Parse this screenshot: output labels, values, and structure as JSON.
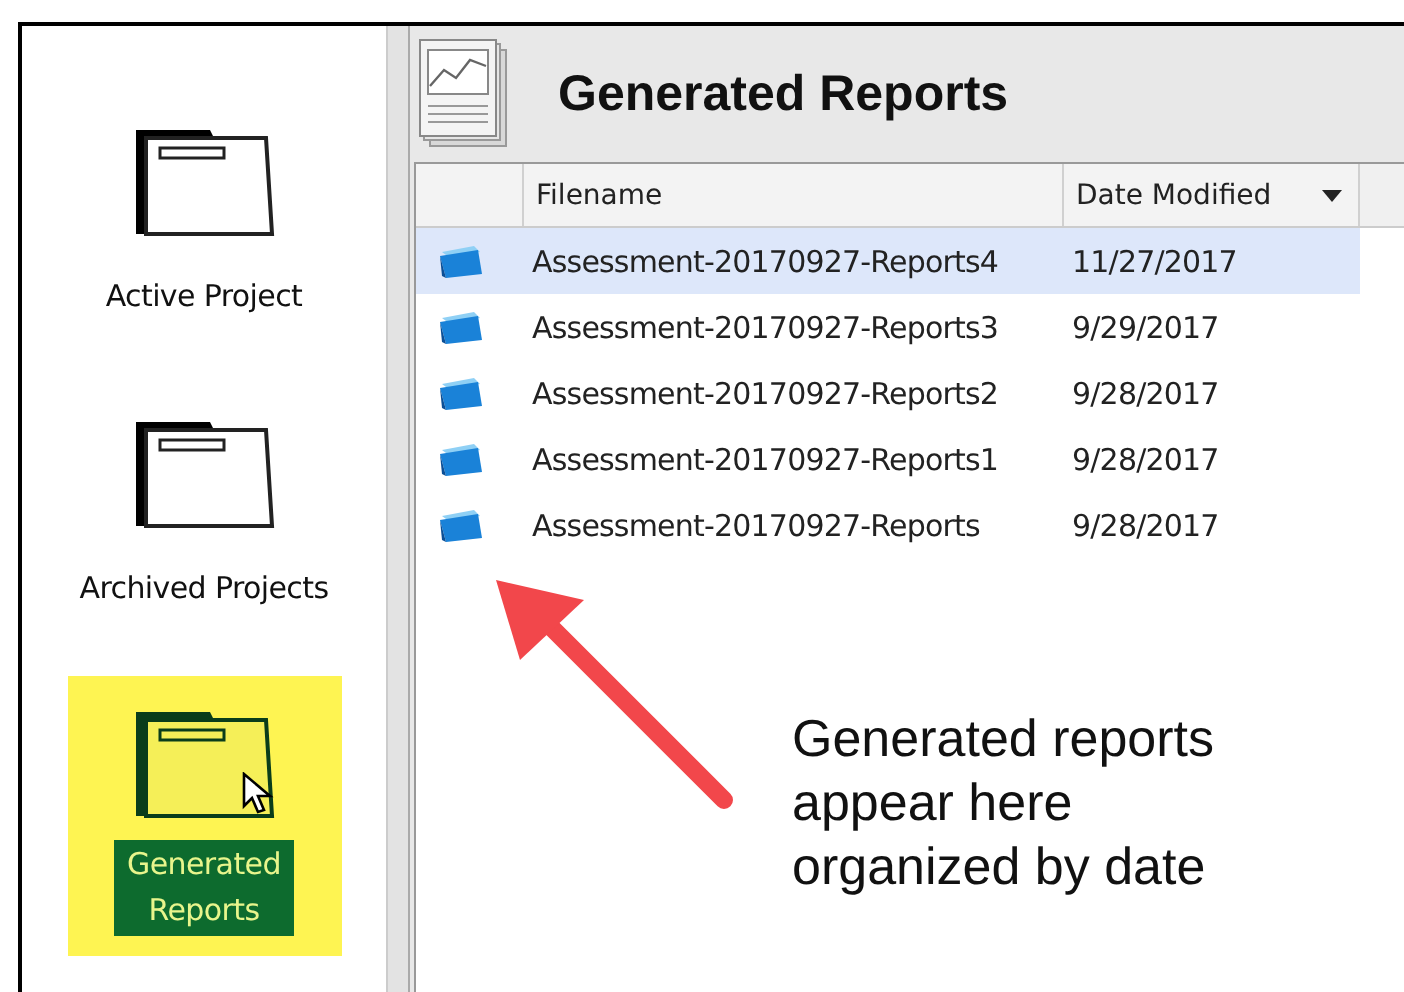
{
  "sidebar": {
    "items": [
      {
        "label": "Active Project",
        "selected": false
      },
      {
        "label": "Archived Projects",
        "selected": false
      },
      {
        "label": "Generated Reports",
        "selected": true
      }
    ]
  },
  "header": {
    "title": "Generated Reports"
  },
  "table": {
    "columns": [
      {
        "label": "Filename",
        "sorted": false
      },
      {
        "label": "Date Modified",
        "sorted": true
      }
    ],
    "rows": [
      {
        "filename": "Assessment-20170927-Reports4",
        "date_modified": "11/27/2017",
        "selected": true
      },
      {
        "filename": "Assessment-20170927-Reports3",
        "date_modified": "9/29/2017",
        "selected": false
      },
      {
        "filename": "Assessment-20170927-Reports2",
        "date_modified": "9/28/2017",
        "selected": false
      },
      {
        "filename": "Assessment-20170927-Reports1",
        "date_modified": "9/28/2017",
        "selected": false
      },
      {
        "filename": "Assessment-20170927-Reports",
        "date_modified": "9/28/2017",
        "selected": false
      }
    ]
  },
  "annotation": {
    "text": "Generated reports appear here organized by date"
  }
}
